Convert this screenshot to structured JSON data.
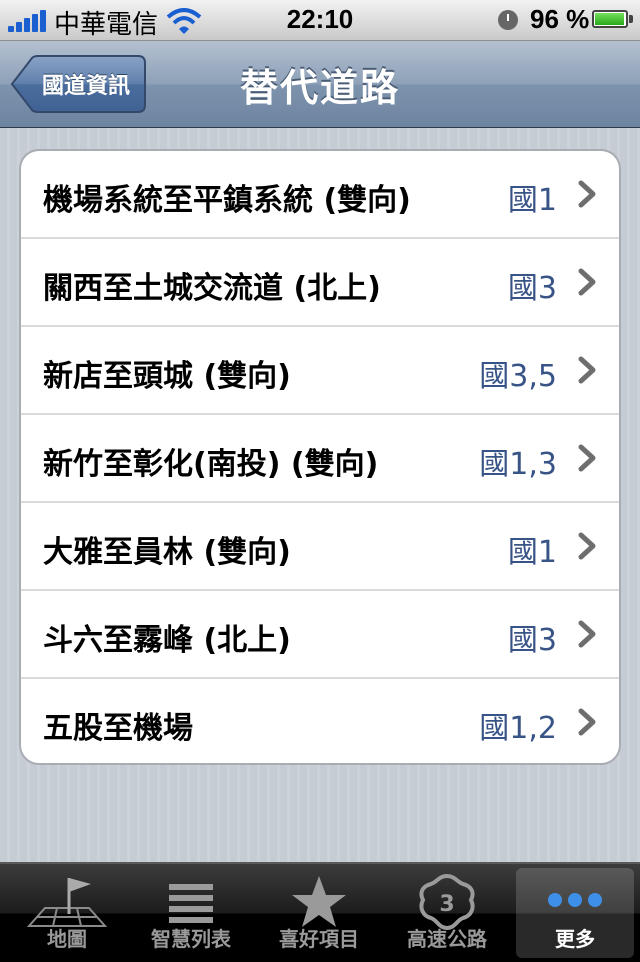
{
  "status_bar": {
    "carrier": "中華電信",
    "time": "22:10",
    "battery": "96 %",
    "battery_level": 0.96
  },
  "nav": {
    "back_label": "國道資訊",
    "title": "替代道路"
  },
  "routes": [
    {
      "name": "機場系統至平鎮系統 (雙向)",
      "road": "國1"
    },
    {
      "name": "關西至土城交流道 (北上)",
      "road": "國3"
    },
    {
      "name": "新店至頭城 (雙向)",
      "road": "國3,5"
    },
    {
      "name": "新竹至彰化(南投) (雙向)",
      "road": "國1,3"
    },
    {
      "name": "大雅至員林 (雙向)",
      "road": "國1"
    },
    {
      "name": "斗六至霧峰 (北上)",
      "road": "國3"
    },
    {
      "name": "五股至機場",
      "road": "國1,2"
    }
  ],
  "tabs": [
    {
      "label": "地圖",
      "icon": "map-flag-icon"
    },
    {
      "label": "智慧列表",
      "icon": "list-icon"
    },
    {
      "label": "喜好項目",
      "icon": "star-icon"
    },
    {
      "label": "高速公路",
      "icon": "freeway-shield-icon"
    },
    {
      "label": "更多",
      "icon": "more-dots-icon"
    }
  ],
  "colors": {
    "nav_bar": "#7e93ad",
    "road_text": "#385487",
    "tab_active_dots": "#3d8fe8"
  }
}
